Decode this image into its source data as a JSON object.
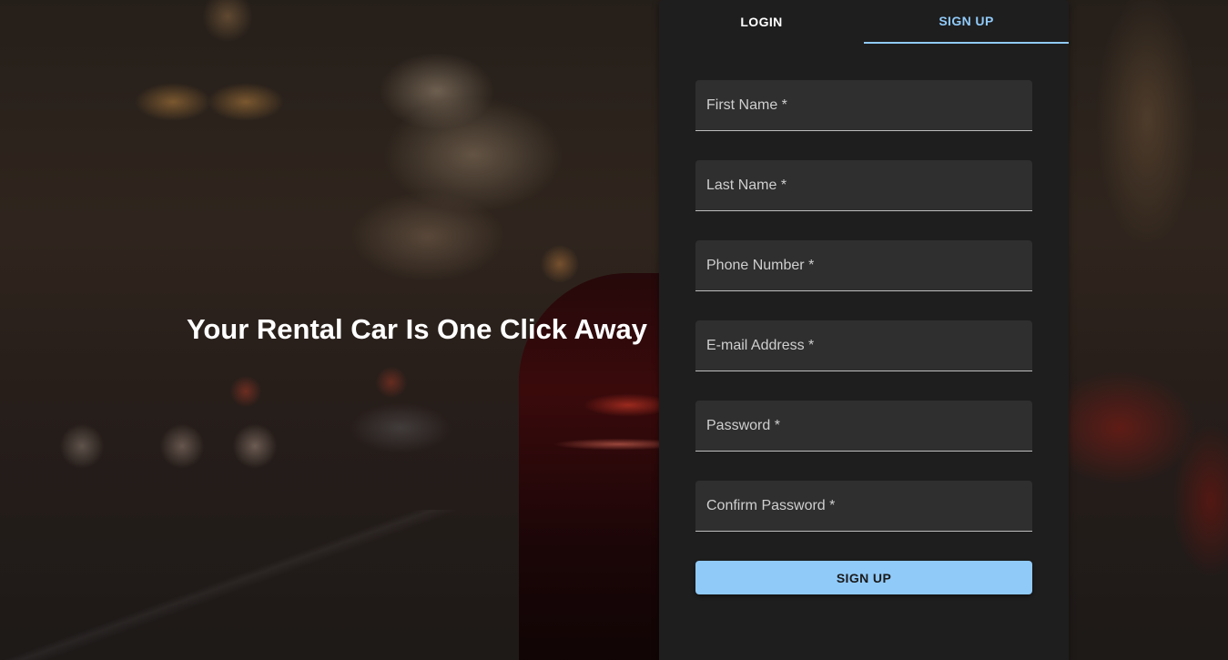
{
  "hero": {
    "tagline": "Your Rental Car Is One Click Away"
  },
  "auth": {
    "tabs": [
      {
        "label": "LOGIN",
        "active": false
      },
      {
        "label": "SIGN UP",
        "active": true
      }
    ],
    "fields": [
      {
        "label": "First Name *",
        "value": ""
      },
      {
        "label": "Last Name *",
        "value": ""
      },
      {
        "label": "Phone Number *",
        "value": ""
      },
      {
        "label": "E-mail Address *",
        "value": ""
      },
      {
        "label": "Password *",
        "value": ""
      },
      {
        "label": "Confirm Password *",
        "value": ""
      }
    ],
    "submit_label": "SIGN UP"
  },
  "colors": {
    "accent": "#90caf9",
    "panel_bg": "#1e1e1e",
    "field_bg": "#2f2f2f"
  }
}
